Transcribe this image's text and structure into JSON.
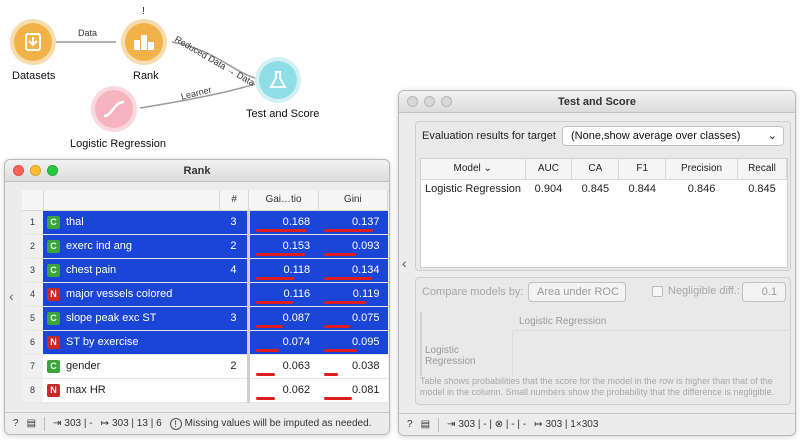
{
  "workflow": {
    "nodes": {
      "datasets": {
        "label": "Datasets"
      },
      "rank": {
        "label": "Rank",
        "warning": "!"
      },
      "logreg": {
        "label": "Logistic Regression"
      },
      "test_score": {
        "label": "Test and Score"
      }
    },
    "links": {
      "data": "Data",
      "reduced": "Reduced Data → Data",
      "learner": "Learner"
    }
  },
  "rank_window": {
    "title": "Rank",
    "headers": {
      "hash": "#",
      "gain": "Gai…tio",
      "gini": "Gini"
    },
    "rows": [
      {
        "index": "1",
        "type": "C",
        "name": "thal",
        "count": "3",
        "gain": "0.168",
        "gini": "0.137",
        "gain_frac": 0.95,
        "gini_frac": 0.9,
        "selected": true
      },
      {
        "index": "2",
        "type": "C",
        "name": "exerc ind ang",
        "count": "2",
        "gain": "0.153",
        "gini": "0.093",
        "gain_frac": 0.9,
        "gini_frac": 0.6,
        "selected": true
      },
      {
        "index": "3",
        "type": "C",
        "name": "chest pain",
        "count": "4",
        "gain": "0.118",
        "gini": "0.134",
        "gain_frac": 0.7,
        "gini_frac": 0.88,
        "selected": true
      },
      {
        "index": "4",
        "type": "N",
        "name": "major vessels colored",
        "count": "",
        "gain": "0.116",
        "gini": "0.119",
        "gain_frac": 0.68,
        "gini_frac": 0.78,
        "selected": true
      },
      {
        "index": "5",
        "type": "C",
        "name": "slope peak exc ST",
        "count": "3",
        "gain": "0.087",
        "gini": "0.075",
        "gain_frac": 0.5,
        "gini_frac": 0.48,
        "selected": true
      },
      {
        "index": "6",
        "type": "N",
        "name": "ST by exercise",
        "count": "",
        "gain": "0.074",
        "gini": "0.095",
        "gain_frac": 0.42,
        "gini_frac": 0.62,
        "selected": true
      },
      {
        "index": "7",
        "type": "C",
        "name": "gender",
        "count": "2",
        "gain": "0.063",
        "gini": "0.038",
        "gain_frac": 0.36,
        "gini_frac": 0.25,
        "selected": false
      },
      {
        "index": "8",
        "type": "N",
        "name": "max HR",
        "count": "",
        "gain": "0.062",
        "gini": "0.081",
        "gain_frac": 0.35,
        "gini_frac": 0.52,
        "selected": false
      }
    ],
    "status": {
      "input": "303 | -",
      "output": "303 | 13 | 6",
      "message": "Missing values will be imputed as needed."
    }
  },
  "test_window": {
    "title": "Test and Score",
    "eval_label": "Evaluation results for target",
    "target_value": "(None,show average over classes)",
    "headers": {
      "model": "Model",
      "auc": "AUC",
      "ca": "CA",
      "f1": "F1",
      "precision": "Precision",
      "recall": "Recall"
    },
    "result": {
      "model": "Logistic Regression",
      "auc": "0.904",
      "ca": "0.845",
      "f1": "0.844",
      "precision": "0.846",
      "recall": "0.845"
    },
    "compare_label": "Compare models by:",
    "compare_value": "Area under ROC",
    "negligible_label": "Negligible diff.:",
    "negligible_value": "0.1",
    "matrix_col": "Logistic Regression",
    "matrix_row": "Logistic Regression",
    "note": "Table shows probabilities that the score for the model in the row is higher than that of the model in the column. Small numbers show the probability that the difference is negligible.",
    "status": {
      "input": "303 | - | ⊗ | - | -",
      "output": "303 | 1×303"
    }
  },
  "colors": {
    "selection": "#1a45d6",
    "bar": "#dd1e1e",
    "continuous": "#3aa53a",
    "numeric": "#c82a2a"
  }
}
